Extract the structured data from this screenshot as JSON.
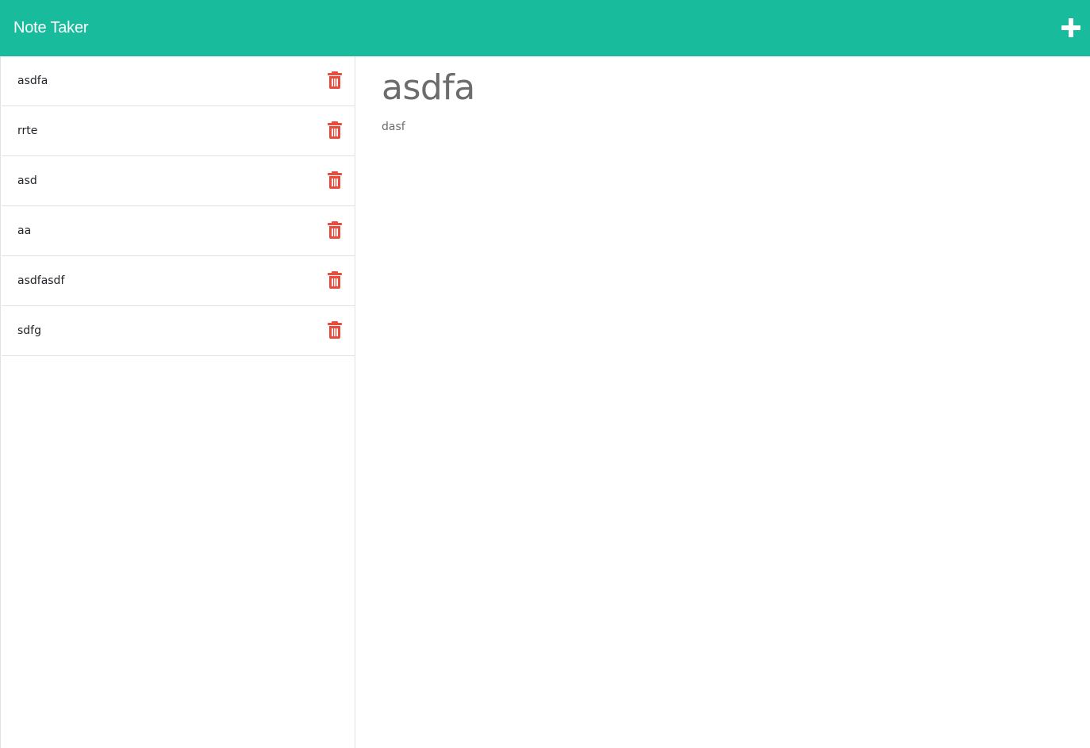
{
  "app": {
    "title": "Note Taker"
  },
  "toolbar": {
    "new_note_icon": "plus-icon"
  },
  "notes": [
    {
      "title": "asdfa"
    },
    {
      "title": "rrte"
    },
    {
      "title": "asd"
    },
    {
      "title": "aa"
    },
    {
      "title": "asdfasdf"
    },
    {
      "title": "sdfg"
    }
  ],
  "active_note": {
    "title": "asdfa",
    "text": "dasf"
  },
  "colors": {
    "navbar": "#18bc9c",
    "delete": "#e74c3c",
    "note_text": "#6c6c6c"
  }
}
